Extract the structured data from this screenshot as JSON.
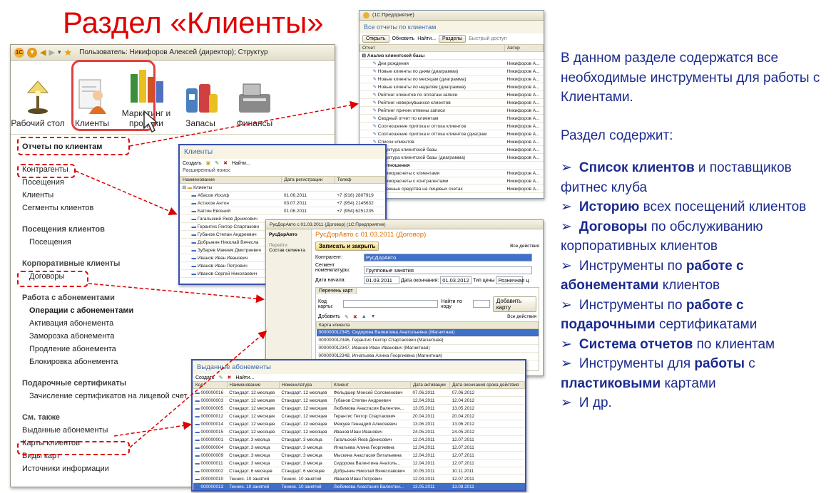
{
  "slide_title": "Раздел «Клиенты»",
  "main_window": {
    "toolbar_user": "Пользователь: Никифоров Алексей (директор);  Структур",
    "sections": [
      {
        "label": "Рабочий стол",
        "icon": "desk-lamp-icon"
      },
      {
        "label": "Клиенты",
        "icon": "clients-icon"
      },
      {
        "label": "Маркетинг и продажи",
        "icon": "chart-icon"
      },
      {
        "label": "Запасы",
        "icon": "stock-icon"
      },
      {
        "label": "Финансы",
        "icon": "cash-register-icon"
      }
    ],
    "nav": {
      "reports": "Отчеты по клиентам",
      "g1": [
        "Контрагенты",
        "Посещения",
        "Клиенты",
        "Сегменты клиентов"
      ],
      "h2": "Посещения клиентов",
      "g2": [
        "Посещения"
      ],
      "h3": "Корпоративные клиенты",
      "g3": [
        "Договоры"
      ],
      "h4": "Работа с абонементами",
      "g4bold": "Операции с абонементами",
      "g4": [
        "Активация абонемента",
        "Заморозка абонемента",
        "Продление абонемента",
        "Блокировка абонемента"
      ],
      "h5": "Подарочные сертификаты",
      "g5": [
        "Зачисление сертификатов на лицевой счет"
      ],
      "h6": "См. также",
      "g6": [
        "Выданные абонементы",
        "Карты клиентов",
        "Виды карт",
        "Источники информации"
      ]
    }
  },
  "reports_window": {
    "tb_title": "(1С:Предприятие)",
    "title": "Все отчеты по клиентам",
    "buttons": [
      "Открыть",
      "Обновить",
      "Найти...",
      "Разделы",
      "Быстрый доступ"
    ],
    "col_report": "Отчет",
    "col_author": "Автор",
    "group1": "Анализ клиентской базы",
    "rows": [
      [
        "Дни рождения",
        "Никифоров А..."
      ],
      [
        "Новые клиенты по дням (диаграмма)",
        "Никифоров А..."
      ],
      [
        "Новые клиенты по месяцам (диаграмма)",
        "Никифоров А..."
      ],
      [
        "Новые клиенты по неделям (диаграмма)",
        "Никифоров А..."
      ],
      [
        "Рейтинг клиентов по оплатам записи",
        "Никифоров А..."
      ],
      [
        "Рейтинг невернувшихся клиентов",
        "Никифоров А..."
      ],
      [
        "Рейтинг причин отмены записи",
        "Никифоров А..."
      ],
      [
        "Сводный отчет по клиентам",
        "Никифоров А..."
      ],
      [
        "Соотношение притока и оттока клиентов",
        "Никифоров А..."
      ],
      [
        "Соотношение притока и оттока клиентов (диаграм",
        "Никифоров А..."
      ],
      [
        "Список клиентов",
        "Никифоров А..."
      ],
      [
        "Структура клиентской базы",
        "Никифоров А..."
      ],
      [
        "Структура клиентской базы (диаграмма)",
        "Никифоров А..."
      ]
    ],
    "group2": "Взаимоотношения",
    "rows2": [
      [
        "Взаиморасчеты с клиентами",
        "Никифоров А..."
      ],
      [
        "Взаиморасчеты с контрагентами",
        "Никифоров А..."
      ],
      [
        "Денежные средства на лицевых счетах",
        "Никифоров А..."
      ]
    ]
  },
  "clients_window": {
    "title": "Клиенты",
    "buttons": [
      "Создать",
      "Найти..."
    ],
    "search_label": "Расширенный поиск:",
    "cols": [
      "Наименование",
      "Дата регистрации",
      "Телеф"
    ],
    "folder": "Клиенты",
    "rows": [
      [
        "Абасов Иосиф",
        "01.06.2011",
        "+7 (916) 2807919"
      ],
      [
        "Астахов Антон",
        "03.07.2011",
        "+7 (954) 2145632"
      ],
      [
        "Баггин Евгений",
        "01.06.2011",
        "+7 (954) 6251235"
      ],
      [
        "Гагальский Яков Денисович",
        "",
        ""
      ],
      [
        "Герантис Гектор Спартаковн",
        "",
        ""
      ],
      [
        "Губанов Степан Андреевич",
        "",
        ""
      ],
      [
        "Добрынин Николай Вячесла",
        "",
        ""
      ],
      [
        "Зубарев Макеем Дмитриевич",
        "",
        ""
      ],
      [
        "Иванов Иван Иванович",
        "",
        ""
      ],
      [
        "Иванов Иван Петрович",
        "",
        ""
      ],
      [
        "Иванов Сергей Николаевич",
        "",
        ""
      ]
    ]
  },
  "contract_window": {
    "tb_title": "РусДорАвто с 01.03.2011 (Договор) (1С:Предприятие)",
    "side_title": "РусДорАвто",
    "side_go": "Перейти",
    "side_item": "Состав сегмента",
    "title": "РусДорАвто с 01.03.2011 (Договор)",
    "save_btn": "Записать и закрыть",
    "all_actions": "Все действия",
    "l_contractor": "Контрагент:",
    "v_contractor": "РусДорАвто",
    "l_segment": "Сегмент номенклатуры:",
    "v_segment": "Групповые занятия",
    "l_start": "Дата начала:",
    "v_start": "01.03.2011",
    "l_end": "Дата окончания:",
    "v_end": "01.03.2012",
    "l_price": "Тип цены",
    "v_price": "Розничная ц",
    "tab": "Перечень карт",
    "l_code": "Код карты:",
    "find_btn": "Найти по коду",
    "add_card": "Добавить карту",
    "add": "Добавить",
    "col_card": "Карта клиента",
    "cards": [
      "000000012345, Сидорова Валентина Анатольевна (Магнитная)",
      "000000012346, Герантис Гектор Спартакович (Магнитная)",
      "000000012347, Иванов Иван Иванович (Магнитная)",
      "000000012348, Игнатьева Алина Георгиевна (Магнитная)"
    ]
  },
  "subs_window": {
    "title": "Выданные абонементы",
    "buttons": [
      "Создать",
      "Найти..."
    ],
    "cols": [
      "Код",
      "Наименование",
      "Номенклатура",
      "Клиент",
      "Дата активации",
      "Дата окончания срока действия"
    ],
    "rows": [
      [
        "000000016",
        "Стандарт. 12 месяцев",
        "Стандарт. 12 месяцев",
        "Фельдшер Моисей Соломонович",
        "07.06.2011",
        "07.06.2012"
      ],
      [
        "000000003",
        "Стандарт. 12 месяцев",
        "Стандарт. 12 месяцев",
        "Губанов Степан Андреевич",
        "12.04.2011",
        "12.04.2012"
      ],
      [
        "000000005",
        "Стандарт. 12 месяцев",
        "Стандарт. 12 месяцев",
        "Любимова Анастасия Валентин...",
        "13.05.2011",
        "13.05.2012"
      ],
      [
        "000000012",
        "Стандарт. 12 месяцев",
        "Стандарт. 12 месяцев",
        "Герантис Гектор Спартакович",
        "20.04.2011",
        "20.04.2012"
      ],
      [
        "000000014",
        "Стандарт. 12 месяцев",
        "Стандарт. 12 месяцев",
        "Межуев Геннадий Алексеевич",
        "13.06.2011",
        "13.06.2012"
      ],
      [
        "000000015",
        "Стандарт. 12 месяцев",
        "Стандарт. 12 месяцев",
        "Иванов Иван Иванович",
        "24.05.2011",
        "24.05.2012"
      ],
      [
        "000000001",
        "Стандарт. 3 месяца",
        "Стандарт. 3 месяца",
        "Гагальский Яков Денисович",
        "12.04.2011",
        "12.07.2011"
      ],
      [
        "000000004",
        "Стандарт. 3 месяца",
        "Стандарт. 3 месяца",
        "Игнатьева Алина Георгиевна",
        "12.04.2011",
        "12.07.2011"
      ],
      [
        "000000009",
        "Стандарт. 3 месяца",
        "Стандарт. 3 месяца",
        "Мыскина Анастасия Витальевна",
        "12.04.2011",
        "12.07.2011"
      ],
      [
        "000000011",
        "Стандарт. 3 месяца",
        "Стандарт. 3 месяца",
        "Сидорова Валентина Анатоль...",
        "12.04.2011",
        "12.07.2011"
      ],
      [
        "000000002",
        "Стандарт. 6 месяцев",
        "Стандарт. 6 месяцев",
        "Добрынин Николай Вячеславович",
        "10.05.2011",
        "10.11.2011"
      ],
      [
        "000000010",
        "Теннис. 10 занятий",
        "Теннис. 10 занятий",
        "Иванов Иван Петрович",
        "12.04.2011",
        "12.07.2011"
      ],
      [
        "000000013",
        "Теннис. 10 занятий",
        "Теннис. 10 занятий",
        "Любимова Анастасия Валентин...",
        "13.05.2011",
        "13.08.2011"
      ]
    ]
  },
  "right_text": {
    "intro": "В данном разделе содержатся все необходимые инструменты для работы с Клиентами.",
    "contains": "Раздел содержит:",
    "items": [
      {
        "b": "Список клиентов",
        "t": " и поставщиков фитнес клуба",
        "pre": ""
      },
      {
        "b": "Историю",
        "t": " всех посещений клиентов",
        "pre": ""
      },
      {
        "b": "Договоры",
        "t": " по обслуживанию корпоративных клиентов",
        "pre": ""
      },
      {
        "pre": "Инструменты по ",
        "b": "работе с абонементами",
        "t": " клиентов"
      },
      {
        "pre": "Инструменты по ",
        "b": "работе с подарочными",
        "t": " сертификатами"
      },
      {
        "b": "Система отчетов",
        "t": " по клиентам",
        "pre": ""
      },
      {
        "pre": "Инструменты для ",
        "b": "работы",
        "t": " с "
      },
      {
        "b": "И др.",
        "t": "",
        "pre": ""
      }
    ],
    "item7_b2": "пластиковыми",
    "item7_t2": " картами",
    "last": "И др."
  },
  "colors": {
    "title_red": "#e00000",
    "text_blue": "#1c2b8e",
    "dash_red": "#dd0000",
    "onec_orange": "#e07000"
  }
}
